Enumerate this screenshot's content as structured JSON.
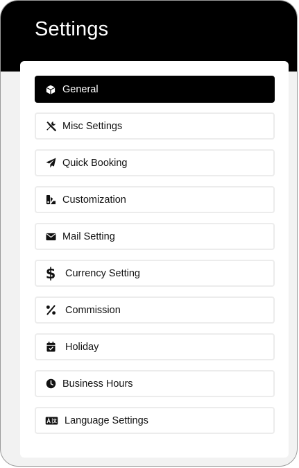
{
  "page": {
    "title": "Settings"
  },
  "menu": {
    "items": [
      {
        "label": "General",
        "icon": "cube-icon",
        "active": true
      },
      {
        "label": "Misc Settings",
        "icon": "tools-icon",
        "active": false
      },
      {
        "label": "Quick Booking",
        "icon": "paper-plane-icon",
        "active": false
      },
      {
        "label": "Customization",
        "icon": "swatchbook-icon",
        "active": false
      },
      {
        "label": "Mail Setting",
        "icon": "envelope-icon",
        "active": false
      },
      {
        "label": "Currency Setting",
        "icon": "dollar-sign-icon",
        "active": false
      },
      {
        "label": "Commission",
        "icon": "percent-icon",
        "active": false
      },
      {
        "label": "Holiday",
        "icon": "calendar-check-icon",
        "active": false
      },
      {
        "label": "Business Hours",
        "icon": "clock-icon",
        "active": false
      },
      {
        "label": "Language Settings",
        "icon": "language-icon",
        "active": false
      }
    ]
  },
  "colors": {
    "header_bg": "#000000",
    "active_bg": "#000000",
    "active_text": "#ffffff",
    "item_border": "#ececec",
    "card_bg": "#f2f2f2"
  }
}
